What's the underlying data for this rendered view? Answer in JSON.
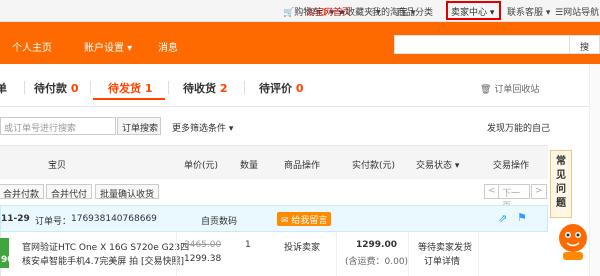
{
  "topbar": {
    "taobao_home": "淘宝网首页",
    "my_taobao": "我的淘宝",
    "cart": "购物车",
    "cart_count": "1",
    "favorites": "收藏夹",
    "categories": "商品分类",
    "seller_center": "卖家中心",
    "contact": "联系客服",
    "site_nav": "网站导航"
  },
  "nav": {
    "profile": "个人主页",
    "account_settings": "账户设置",
    "messages": "消息",
    "search_button": "搜"
  },
  "tabs": [
    {
      "label": "订单",
      "count": ""
    },
    {
      "label": "待付款",
      "count": "0"
    },
    {
      "label": "待发货",
      "count": "1"
    },
    {
      "label": "待收货",
      "count": "2"
    },
    {
      "label": "待评价",
      "count": "0"
    }
  ],
  "recycle_bin": "订单回收站",
  "filter": {
    "placeholder": "或订单号进行搜索",
    "search_button": "订单搜索",
    "more_filters": "更多筛选条件",
    "discover": "发现万能的自己"
  },
  "table_headers": {
    "item": "宝贝",
    "unit_price": "单价(元)",
    "quantity": "数量",
    "item_ops": "商品操作",
    "actual_paid": "实付款(元)",
    "status": "交易状态",
    "trade_ops": "交易操作"
  },
  "actions": {
    "merge_pay": "合并付款",
    "merge_pay_agent": "合并代付",
    "batch_confirm": "批量确认收货",
    "prev": "<",
    "next_label": "下一页",
    "next": ">"
  },
  "order": {
    "date": "11-29",
    "order_no_label": "订单号：",
    "order_no": "176938140768669",
    "shop": "自贡数码",
    "chat": "给我留言",
    "title_line1": "官网验证HTC One X 16G S720e G23四",
    "title_line2": "核安卓智能手机4.7完美屏 拍 [交易快照]",
    "orig_price": "3465.00",
    "price": "1299.38",
    "quantity": "1",
    "refund": "投诉卖家",
    "paid": "1299.00",
    "shipping": "(含运费：0.00)",
    "status": "等待卖家发货",
    "detail": "订单详情"
  },
  "help": {
    "c1": "常",
    "c2": "见",
    "c3": "问",
    "c4": "题"
  }
}
